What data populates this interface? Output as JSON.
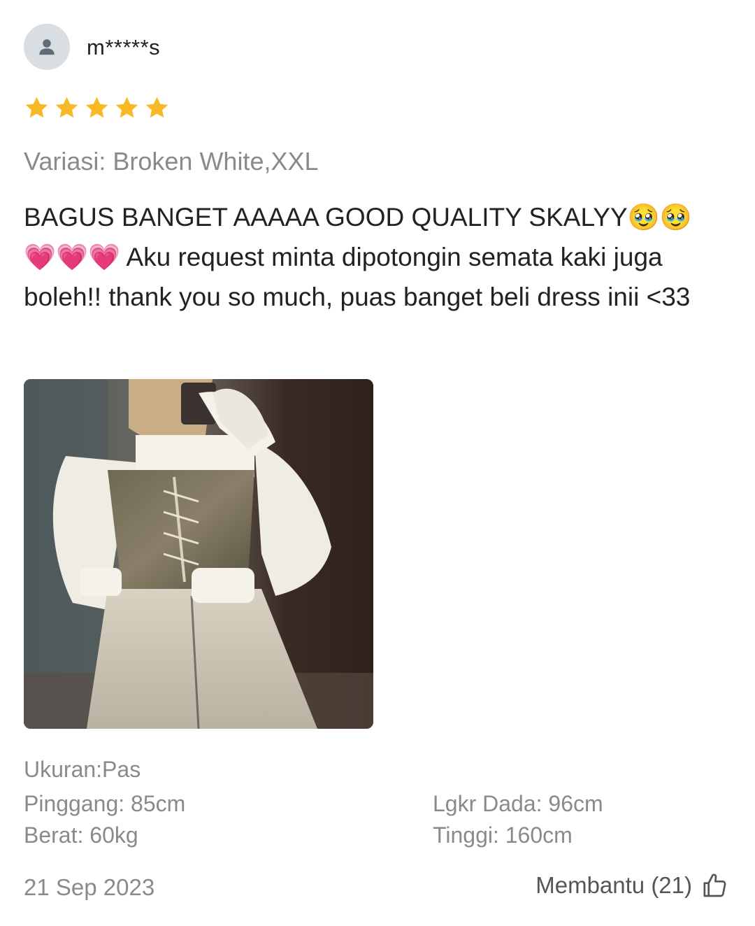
{
  "review": {
    "username": "m*****s",
    "rating": 5,
    "rating_max": 5,
    "variation": "Variasi: Broken White,XXL",
    "text": "BAGUS BANGET AAAAA GOOD QUALITY SKALYY🥹🥹\n💗💗💗 Aku request minta dipotongin semata kaki juga boleh!! thank you so much, puas banget beli dress inii <33",
    "photo_icon": "review-photo",
    "attributes": {
      "ukuran": "Ukuran:Pas",
      "pinggang": "Pinggang: 85cm",
      "lingkar_dada": "Lgkr Dada: 96cm",
      "berat": "Berat: 60kg",
      "tinggi": "Tinggi: 160cm"
    },
    "date": "21 Sep 2023",
    "helpful_label": "Membantu (21)"
  },
  "icons": {
    "avatar": "person-icon",
    "star": "star-icon",
    "helpful": "thumbs-up-icon"
  },
  "colors": {
    "star": "#F9B826",
    "muted_text": "#8a8a8a",
    "avatar_bg": "#d9dee3",
    "avatar_fg": "#5f6b77"
  }
}
